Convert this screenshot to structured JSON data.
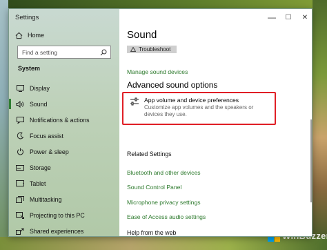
{
  "window": {
    "app_title": "Settings",
    "minimize_glyph": "—",
    "maximize_glyph": "☐",
    "close_glyph": "✕"
  },
  "sidebar": {
    "home_label": "Home",
    "search_placeholder": "Find a setting",
    "section_label": "System",
    "items": [
      {
        "label": "Display",
        "icon": "display-icon"
      },
      {
        "label": "Sound",
        "icon": "speaker-icon",
        "active": true
      },
      {
        "label": "Notifications & actions",
        "icon": "notifications-icon"
      },
      {
        "label": "Focus assist",
        "icon": "focus-assist-icon"
      },
      {
        "label": "Power & sleep",
        "icon": "power-icon"
      },
      {
        "label": "Storage",
        "icon": "storage-icon"
      },
      {
        "label": "Tablet",
        "icon": "tablet-icon"
      },
      {
        "label": "Multitasking",
        "icon": "multitasking-icon"
      },
      {
        "label": "Projecting to this PC",
        "icon": "projecting-icon"
      },
      {
        "label": "Shared experiences",
        "icon": "shared-experiences-icon"
      }
    ]
  },
  "main": {
    "title": "Sound",
    "troubleshoot_label": "Troubleshoot",
    "manage_devices_link": "Manage sound devices",
    "advanced_title": "Advanced sound options",
    "app_volume": {
      "title": "App volume and device preferences",
      "description": "Customize app volumes and the speakers or devices they use."
    },
    "related_title": "Related Settings",
    "related_links": [
      "Bluetooth and other devices",
      "Sound Control Panel",
      "Microphone privacy settings",
      "Ease of Access audio settings"
    ],
    "help_title": "Help from the web"
  },
  "watermark": {
    "text": "WinBuzzer"
  },
  "colors": {
    "accent_green": "#2d7a2d",
    "highlight_red": "#e01e25",
    "active_indicator": "#2e7d32"
  }
}
